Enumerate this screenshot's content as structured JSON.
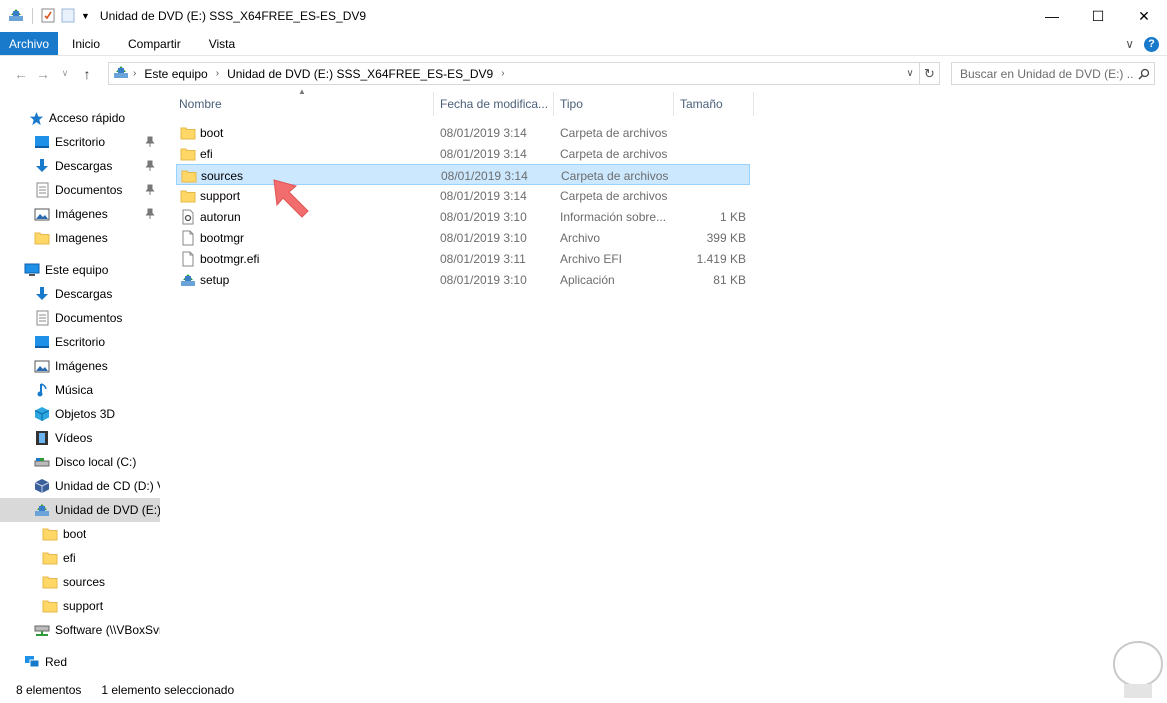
{
  "window": {
    "title": "Unidad de DVD (E:) SSS_X64FREE_ES-ES_DV9",
    "controls": {
      "minimize": "—",
      "maximize": "☐",
      "close": "✕"
    }
  },
  "ribbon": {
    "file_tab": "Archivo",
    "tabs": [
      "Inicio",
      "Compartir",
      "Vista"
    ],
    "expand": "∨",
    "help": "?"
  },
  "address": {
    "crumbs": [
      "Este equipo",
      "Unidad de DVD (E:) SSS_X64FREE_ES-ES_DV9"
    ]
  },
  "search": {
    "placeholder": "Buscar en Unidad de DVD (E:) ..."
  },
  "nav": {
    "quick_access": "Acceso rápido",
    "quick_items": [
      "Escritorio",
      "Descargas",
      "Documentos",
      "Imágenes",
      "Imagenes"
    ],
    "this_pc": "Este equipo",
    "pc_items": [
      "Descargas",
      "Documentos",
      "Escritorio",
      "Imágenes",
      "Música",
      "Objetos 3D",
      "Vídeos",
      "Disco local (C:)",
      "Unidad de CD (D:) V",
      "Unidad de DVD (E:)"
    ],
    "dvd_children": [
      "boot",
      "efi",
      "sources",
      "support"
    ],
    "network_share": "Software (\\\\VBoxSvr",
    "network": "Red"
  },
  "columns": {
    "name": "Nombre",
    "date": "Fecha de modifica...",
    "type": "Tipo",
    "size": "Tamaño"
  },
  "files": [
    {
      "name": "boot",
      "date": "08/01/2019 3:14",
      "type": "Carpeta de archivos",
      "size": "",
      "icon": "folder-icon"
    },
    {
      "name": "efi",
      "date": "08/01/2019 3:14",
      "type": "Carpeta de archivos",
      "size": "",
      "icon": "folder-icon"
    },
    {
      "name": "sources",
      "date": "08/01/2019 3:14",
      "type": "Carpeta de archivos",
      "size": "",
      "icon": "folder-icon",
      "selected": true
    },
    {
      "name": "support",
      "date": "08/01/2019 3:14",
      "type": "Carpeta de archivos",
      "size": "",
      "icon": "folder-icon"
    },
    {
      "name": "autorun",
      "date": "08/01/2019 3:10",
      "type": "Información sobre...",
      "size": "1 KB",
      "icon": "settings-file-icon"
    },
    {
      "name": "bootmgr",
      "date": "08/01/2019 3:10",
      "type": "Archivo",
      "size": "399 KB",
      "icon": "file-icon"
    },
    {
      "name": "bootmgr.efi",
      "date": "08/01/2019 3:11",
      "type": "Archivo EFI",
      "size": "1.419 KB",
      "icon": "file-icon"
    },
    {
      "name": "setup",
      "date": "08/01/2019 3:10",
      "type": "Aplicación",
      "size": "81 KB",
      "icon": "setup-icon"
    }
  ],
  "status": {
    "count": "8 elementos",
    "selection": "1 elemento seleccionado"
  },
  "colors": {
    "accent": "#1979ca",
    "selection": "#cce8ff",
    "selection_border": "#99d1ff",
    "folder": "#ffd767"
  }
}
